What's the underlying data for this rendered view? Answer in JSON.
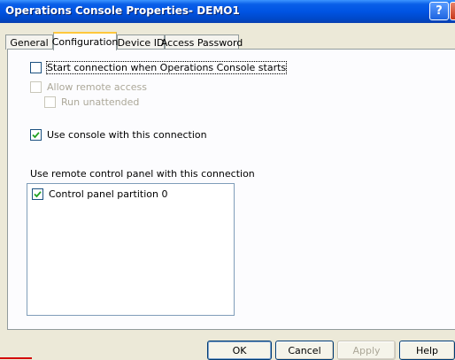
{
  "window": {
    "title": "Operations Console Properties- DEMO1",
    "help_button": "?",
    "close_button": "X"
  },
  "tabs": [
    {
      "label": "General",
      "active": false
    },
    {
      "label": "Configuration",
      "active": true
    },
    {
      "label": "Device ID",
      "active": false
    },
    {
      "label": "Access Password",
      "active": false
    }
  ],
  "configuration": {
    "start_connection": {
      "label": "Start connection when Operations Console starts",
      "checked": false,
      "enabled": true
    },
    "allow_remote_access": {
      "label": "Allow remote access",
      "checked": false,
      "enabled": false
    },
    "run_unattended": {
      "label": "Run unattended",
      "checked": false,
      "enabled": false
    },
    "use_console": {
      "label": "Use console with this connection",
      "checked": true,
      "enabled": true
    },
    "remote_panel_label": "Use remote control panel with this connection",
    "partitions": [
      {
        "label": "Control panel partition 0",
        "checked": true
      }
    ]
  },
  "buttons": {
    "ok": "OK",
    "cancel": "Cancel",
    "apply": "Apply",
    "help": "Help"
  },
  "colors": {
    "title_bar": "#0054e3",
    "dialog_face": "#ece9d8",
    "tab_accent": "#ffc83c"
  }
}
